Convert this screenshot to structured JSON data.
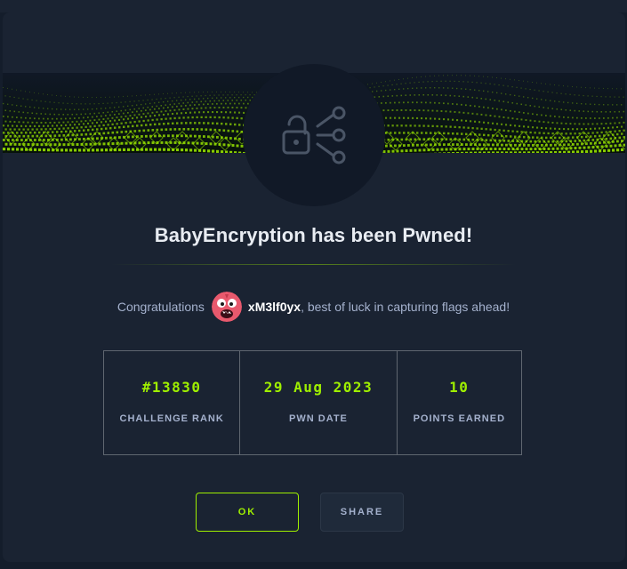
{
  "modal": {
    "title": "BabyEncryption has been Pwned!",
    "challenge_icon": "lock-share-icon",
    "banner_image": "green-digital-wave-banner"
  },
  "congrats": {
    "prefix": "Congratulations",
    "avatar": "pink-monster-avatar",
    "username": "xM3lf0yx",
    "suffix": ", best of luck in capturing flags ahead!"
  },
  "stats": [
    {
      "value": "#13830",
      "label": "CHALLENGE RANK"
    },
    {
      "value": "29 Aug 2023",
      "label": "PWN DATE"
    },
    {
      "value": "10",
      "label": "POINTS EARNED"
    }
  ],
  "buttons": {
    "ok": "OK",
    "share": "SHARE"
  },
  "colors": {
    "accent": "#9fef00",
    "background": "#141d2b",
    "modal": "#1a2332",
    "text": "#a4b1cd"
  }
}
